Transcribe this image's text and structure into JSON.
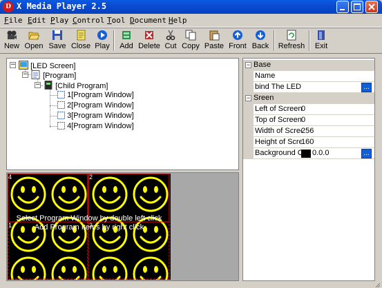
{
  "window": {
    "title": "X Media Player 2.5",
    "app_icon_text": "D"
  },
  "menu": [
    {
      "label": "File"
    },
    {
      "label": "Edit"
    },
    {
      "label": "Play"
    },
    {
      "label": "Control"
    },
    {
      "label": "Tool"
    },
    {
      "label": "Document"
    },
    {
      "label": "Help"
    }
  ],
  "toolbar": [
    {
      "label": "New",
      "icon": "film-icon"
    },
    {
      "label": "Open",
      "icon": "folder-open-icon"
    },
    {
      "label": "Save",
      "icon": "floppy-disk-icon"
    },
    {
      "label": "Close",
      "icon": "close-document-icon"
    },
    {
      "label": "Play",
      "icon": "play-icon"
    },
    {
      "label": "Add",
      "icon": "add-window-icon"
    },
    {
      "label": "Delete",
      "icon": "delete-window-icon"
    },
    {
      "label": "Cut",
      "icon": "scissors-icon"
    },
    {
      "label": "Copy",
      "icon": "copy-icon"
    },
    {
      "label": "Paste",
      "icon": "paste-icon"
    },
    {
      "label": "Front",
      "icon": "arrow-up-icon"
    },
    {
      "label": "Back",
      "icon": "arrow-down-icon"
    },
    {
      "label": "Refresh",
      "icon": "refresh-icon"
    },
    {
      "label": "Exit",
      "icon": "exit-door-icon"
    }
  ],
  "tree": {
    "root": "[LED Screen]",
    "program": "[Program]",
    "child": "[Child Program]",
    "windows": [
      "1[Program Window]",
      "2[Program Window]",
      "3[Program Window]",
      "4[Program Window]"
    ]
  },
  "properties": {
    "base_category": "Base",
    "name_label": "Name",
    "name_value": "",
    "bind_label": "bind The LED",
    "screen_category": "Sreen",
    "left_label": "Left of Screen",
    "left_value": "0",
    "top_label": "Top of Screen",
    "top_value": "0",
    "width_label": "Width of Scree",
    "width_value": "256",
    "height_label": "Height of Scre",
    "height_value": "160",
    "bg_label": "Background Co",
    "bg_value": "0.0.0",
    "bg_color": "#000000",
    "ellipsis": "..."
  },
  "preview": {
    "window_labels": [
      "4",
      "2",
      "1",
      "3"
    ],
    "hint_line1": "Select Program Window by double left click",
    "hint_line2": "Add Program Items by right click",
    "smiley_color": "#ffff00",
    "border_color": "#ff0000"
  }
}
